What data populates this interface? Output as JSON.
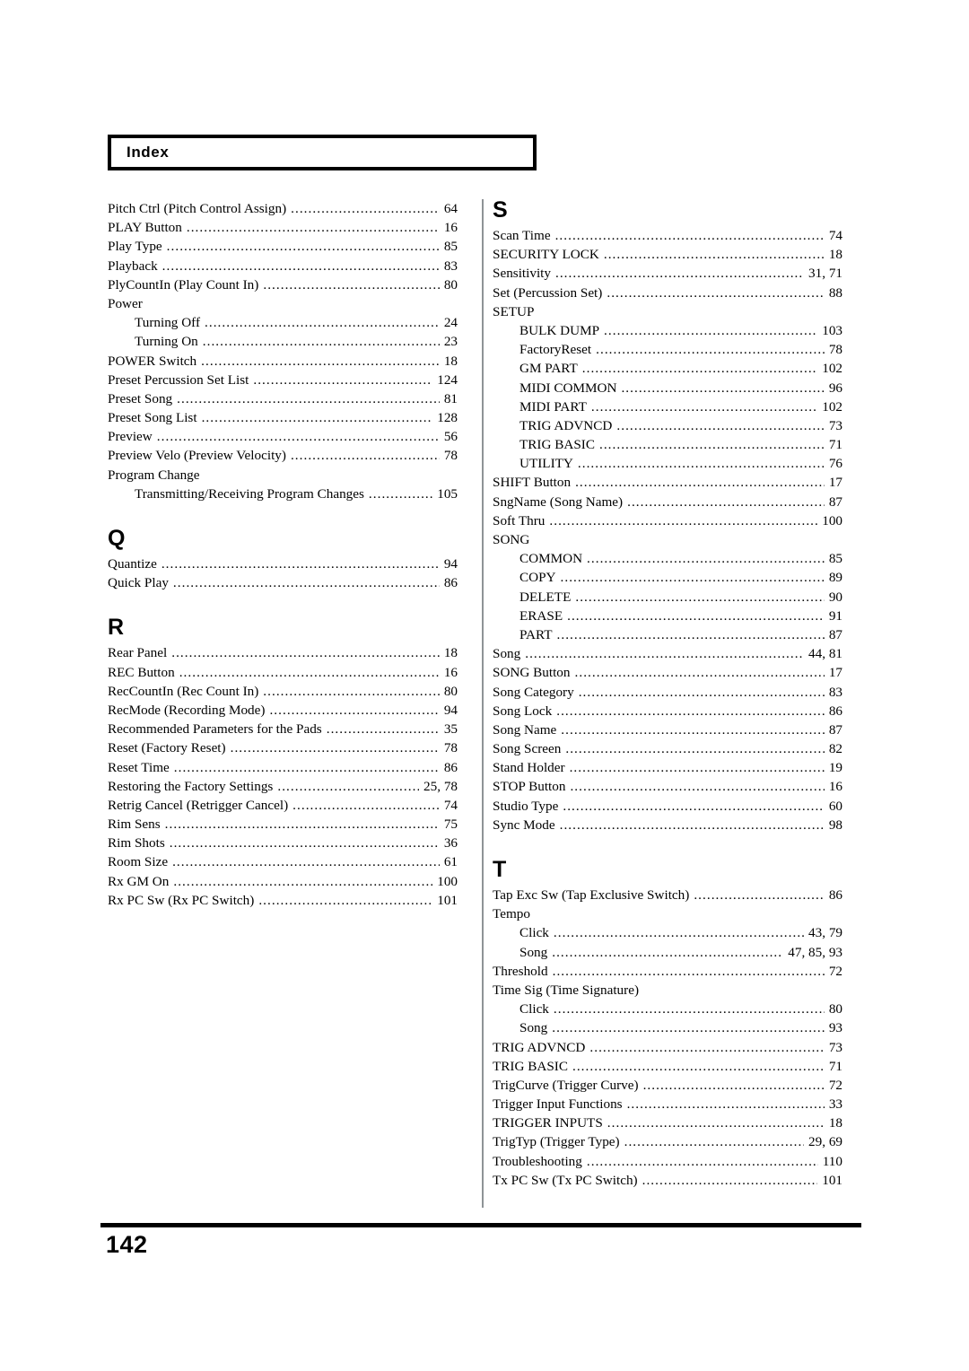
{
  "header": {
    "title": "Index"
  },
  "footer": {
    "page_number": "142"
  },
  "columns": {
    "left": [
      {
        "kind": "entry",
        "term": "Pitch Ctrl (Pitch Control Assign)",
        "page": "64"
      },
      {
        "kind": "entry",
        "term": "PLAY Button",
        "page": "16"
      },
      {
        "kind": "entry",
        "term": "Play Type",
        "page": "85"
      },
      {
        "kind": "entry",
        "term": "Playback",
        "page": "83"
      },
      {
        "kind": "entry",
        "term": "PlyCountIn (Play Count In)",
        "page": "80"
      },
      {
        "kind": "group",
        "term": "Power"
      },
      {
        "kind": "sub",
        "term": "Turning Off",
        "page": "24"
      },
      {
        "kind": "sub",
        "term": "Turning On",
        "page": "23"
      },
      {
        "kind": "entry",
        "term": "POWER Switch",
        "page": "18"
      },
      {
        "kind": "entry",
        "term": "Preset Percussion Set List",
        "page": "124"
      },
      {
        "kind": "entry",
        "term": "Preset Song",
        "page": "81"
      },
      {
        "kind": "entry",
        "term": "Preset Song List",
        "page": "128"
      },
      {
        "kind": "entry",
        "term": "Preview",
        "page": "56"
      },
      {
        "kind": "entry",
        "term": "Preview Velo (Preview Velocity)",
        "page": "78"
      },
      {
        "kind": "group",
        "term": "Program Change"
      },
      {
        "kind": "sub",
        "term": "Transmitting/Receiving Program Changes",
        "page": "105"
      },
      {
        "kind": "letter",
        "term": "Q"
      },
      {
        "kind": "entry",
        "term": "Quantize",
        "page": "94"
      },
      {
        "kind": "entry",
        "term": "Quick Play",
        "page": "86"
      },
      {
        "kind": "letter",
        "term": "R"
      },
      {
        "kind": "entry",
        "term": "Rear Panel",
        "page": "18"
      },
      {
        "kind": "entry",
        "term": "REC Button",
        "page": "16"
      },
      {
        "kind": "entry",
        "term": "RecCountIn (Rec Count In)",
        "page": "80"
      },
      {
        "kind": "entry",
        "term": "RecMode (Recording Mode)",
        "page": "94"
      },
      {
        "kind": "entry",
        "term": "Recommended Parameters for the Pads",
        "page": "35"
      },
      {
        "kind": "entry",
        "term": "Reset (Factory Reset)",
        "page": "78"
      },
      {
        "kind": "entry",
        "term": "Reset Time",
        "page": "86"
      },
      {
        "kind": "entry",
        "term": "Restoring the Factory Settings",
        "page": "25, 78"
      },
      {
        "kind": "entry",
        "term": "Retrig Cancel (Retrigger Cancel)",
        "page": "74"
      },
      {
        "kind": "entry",
        "term": "Rim Sens",
        "page": "75"
      },
      {
        "kind": "entry",
        "term": "Rim Shots",
        "page": "36"
      },
      {
        "kind": "entry",
        "term": "Room Size",
        "page": "61"
      },
      {
        "kind": "entry",
        "term": "Rx GM On",
        "page": "100"
      },
      {
        "kind": "entry",
        "term": "Rx PC Sw (Rx PC Switch)",
        "page": "101"
      }
    ],
    "right": [
      {
        "kind": "letter-first",
        "term": "S"
      },
      {
        "kind": "entry",
        "term": "Scan Time",
        "page": "74"
      },
      {
        "kind": "entry",
        "term": "SECURITY LOCK",
        "page": "18"
      },
      {
        "kind": "entry",
        "term": "Sensitivity",
        "page": "31, 71"
      },
      {
        "kind": "entry",
        "term": "Set (Percussion Set)",
        "page": "88"
      },
      {
        "kind": "group",
        "term": "SETUP"
      },
      {
        "kind": "sub",
        "term": "BULK DUMP",
        "page": "103"
      },
      {
        "kind": "sub",
        "term": "FactoryReset",
        "page": "78"
      },
      {
        "kind": "sub",
        "term": "GM PART",
        "page": "102"
      },
      {
        "kind": "sub",
        "term": "MIDI COMMON",
        "page": "96"
      },
      {
        "kind": "sub",
        "term": "MIDI PART",
        "page": "102"
      },
      {
        "kind": "sub",
        "term": "TRIG ADVNCD",
        "page": "73"
      },
      {
        "kind": "sub",
        "term": "TRIG BASIC",
        "page": "71"
      },
      {
        "kind": "sub",
        "term": "UTILITY",
        "page": "76"
      },
      {
        "kind": "entry",
        "term": "SHIFT Button",
        "page": "17"
      },
      {
        "kind": "entry",
        "term": "SngName (Song Name)",
        "page": "87"
      },
      {
        "kind": "entry",
        "term": "Soft Thru",
        "page": "100"
      },
      {
        "kind": "group",
        "term": "SONG"
      },
      {
        "kind": "sub",
        "term": "COMMON",
        "page": "85"
      },
      {
        "kind": "sub",
        "term": "COPY",
        "page": "89"
      },
      {
        "kind": "sub",
        "term": "DELETE",
        "page": "90"
      },
      {
        "kind": "sub",
        "term": "ERASE",
        "page": "91"
      },
      {
        "kind": "sub",
        "term": "PART",
        "page": "87"
      },
      {
        "kind": "entry",
        "term": "Song",
        "page": "44, 81"
      },
      {
        "kind": "entry",
        "term": "SONG Button",
        "page": "17"
      },
      {
        "kind": "entry",
        "term": "Song Category",
        "page": "83"
      },
      {
        "kind": "entry",
        "term": "Song Lock",
        "page": "86"
      },
      {
        "kind": "entry",
        "term": "Song Name",
        "page": "87"
      },
      {
        "kind": "entry",
        "term": "Song Screen",
        "page": "82"
      },
      {
        "kind": "entry",
        "term": "Stand Holder",
        "page": "19"
      },
      {
        "kind": "entry",
        "term": "STOP Button",
        "page": "16"
      },
      {
        "kind": "entry",
        "term": "Studio Type",
        "page": "60"
      },
      {
        "kind": "entry",
        "term": "Sync Mode",
        "page": "98"
      },
      {
        "kind": "letter",
        "term": "T"
      },
      {
        "kind": "entry",
        "term": "Tap Exc Sw (Tap Exclusive Switch)",
        "page": "86"
      },
      {
        "kind": "group",
        "term": "Tempo"
      },
      {
        "kind": "sub",
        "term": "Click",
        "page": "43, 79"
      },
      {
        "kind": "sub",
        "term": "Song",
        "page": "47, 85, 93"
      },
      {
        "kind": "entry",
        "term": "Threshold",
        "page": "72"
      },
      {
        "kind": "group",
        "term": "Time Sig (Time Signature)"
      },
      {
        "kind": "sub",
        "term": "Click",
        "page": "80"
      },
      {
        "kind": "sub",
        "term": "Song",
        "page": "93"
      },
      {
        "kind": "entry",
        "term": "TRIG ADVNCD",
        "page": "73"
      },
      {
        "kind": "entry",
        "term": "TRIG BASIC",
        "page": "71"
      },
      {
        "kind": "entry",
        "term": "TrigCurve (Trigger Curve)",
        "page": "72"
      },
      {
        "kind": "entry",
        "term": "Trigger Input Functions",
        "page": "33"
      },
      {
        "kind": "entry",
        "term": "TRIGGER INPUTS",
        "page": "18"
      },
      {
        "kind": "entry",
        "term": "TrigTyp (Trigger Type)",
        "page": "29, 69"
      },
      {
        "kind": "entry",
        "term": "Troubleshooting",
        "page": "110"
      },
      {
        "kind": "entry",
        "term": "Tx PC Sw (Tx PC Switch)",
        "page": "101"
      }
    ]
  }
}
